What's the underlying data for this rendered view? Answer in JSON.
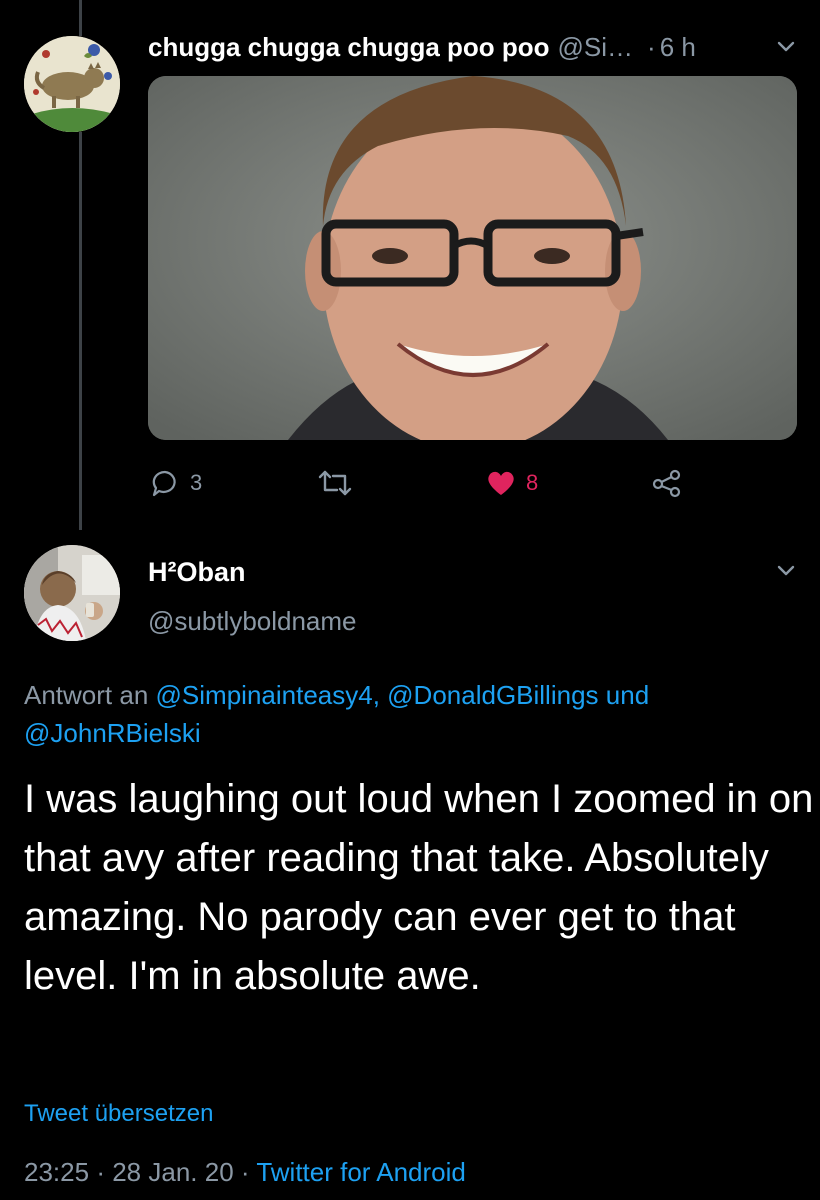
{
  "tweet1": {
    "display_name": "chugga chugga chugga poo poo",
    "handle": "@Si…",
    "separator": "·",
    "time": "6 h",
    "reply_count": "3",
    "like_count": "8"
  },
  "tweet2": {
    "display_name": "H²Oban",
    "handle": "@subtlyboldname",
    "reply_prefix": "Antwort an",
    "mentions": [
      "@Simpinainteasy4,",
      "@DonaldGBillings",
      "@JohnRBielski"
    ],
    "mention_joiner": "und",
    "text": "I was laughing out loud when I zoomed in on that avy after reading that take. Absolutely amazing. No parody can ever get to that level. I'm in absolute awe.",
    "translate_label": "Tweet übersetzen",
    "time": "23:25",
    "date": "28 Jan. 20",
    "separator": "·",
    "source": "Twitter for Android"
  },
  "colors": {
    "background": "#000000",
    "muted": "#8b98a5",
    "link": "#1da1f2",
    "like": "#e0245e"
  }
}
